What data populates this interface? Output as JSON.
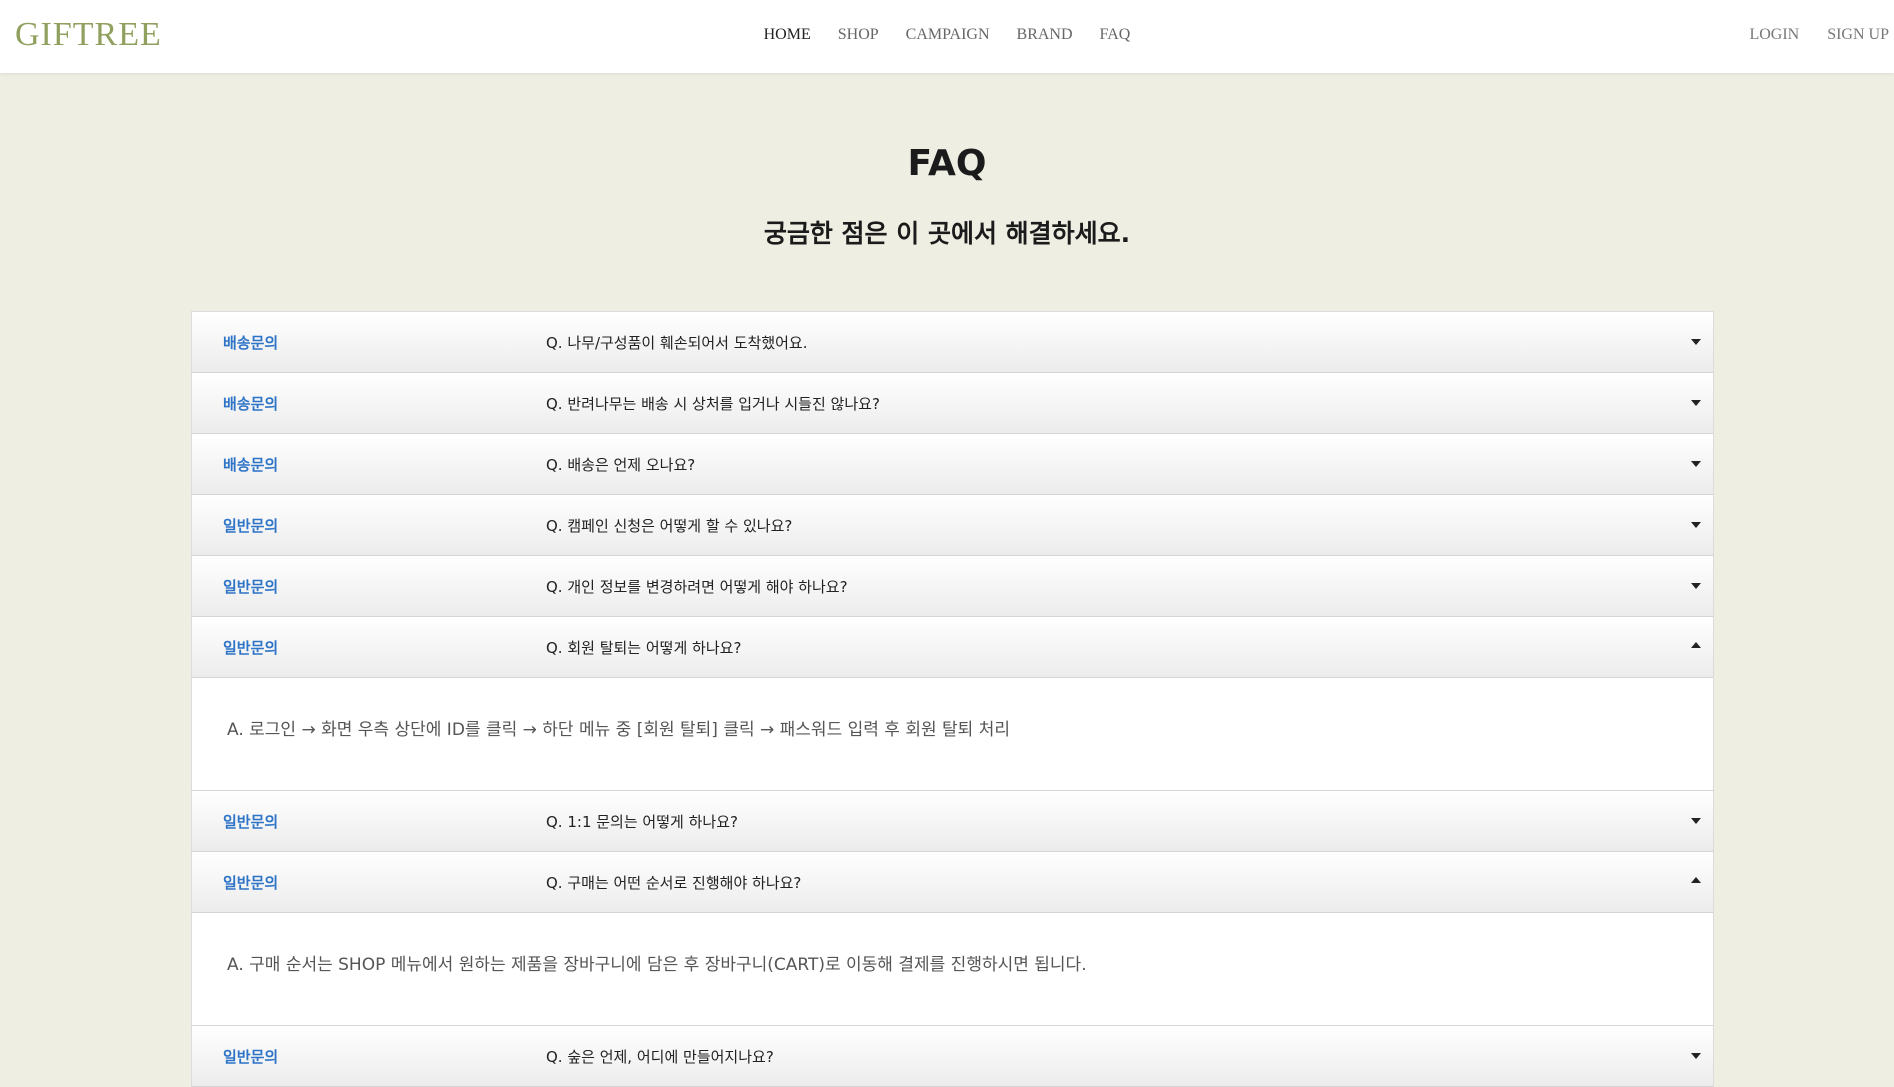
{
  "header": {
    "logo": "GIFTREE",
    "nav": [
      {
        "label": "HOME",
        "active": true
      },
      {
        "label": "SHOP",
        "active": false
      },
      {
        "label": "CAMPAIGN",
        "active": false
      },
      {
        "label": "BRAND",
        "active": false
      },
      {
        "label": "FAQ",
        "active": false
      }
    ],
    "login": "LOGIN",
    "signup": "SIGN UP"
  },
  "page": {
    "title": "FAQ",
    "subtitle": "궁금한 점은 이 곳에서 해결하세요."
  },
  "faqs": [
    {
      "category": "배송문의",
      "question": "Q. 나무/구성품이 훼손되어서 도착했어요.",
      "expanded": false,
      "answer": ""
    },
    {
      "category": "배송문의",
      "question": "Q. 반려나무는 배송 시 상처를 입거나 시들진 않나요?",
      "expanded": false,
      "answer": ""
    },
    {
      "category": "배송문의",
      "question": "Q. 배송은 언제 오나요?",
      "expanded": false,
      "answer": ""
    },
    {
      "category": "일반문의",
      "question": "Q. 캠페인 신청은 어떻게 할 수 있나요?",
      "expanded": false,
      "answer": ""
    },
    {
      "category": "일반문의",
      "question": "Q. 개인 정보를 변경하려면 어떻게 해야 하나요?",
      "expanded": false,
      "answer": ""
    },
    {
      "category": "일반문의",
      "question": "Q. 회원 탈퇴는 어떻게 하나요?",
      "expanded": true,
      "answer": "A. 로그인 → 화면 우측 상단에 ID를 클릭 → 하단 메뉴 중 [회원 탈퇴] 클릭 → 패스워드 입력 후 회원 탈퇴 처리"
    },
    {
      "category": "일반문의",
      "question": "Q. 1:1 문의는 어떻게 하나요?",
      "expanded": false,
      "answer": ""
    },
    {
      "category": "일반문의",
      "question": "Q. 구매는 어떤 순서로 진행해야 하나요?",
      "expanded": true,
      "answer": "A. 구매 순서는 SHOP 메뉴에서 원하는 제품을 장바구니에 담은 후 장바구니(CART)로 이동해 결제를 진행하시면 됩니다."
    },
    {
      "category": "일반문의",
      "question": "Q. 숲은 언제, 어디에 만들어지나요?",
      "expanded": false,
      "answer": ""
    }
  ],
  "colors": {
    "background": "#efeee3",
    "logo": "#8fa05f",
    "category": "#2e74c7"
  }
}
